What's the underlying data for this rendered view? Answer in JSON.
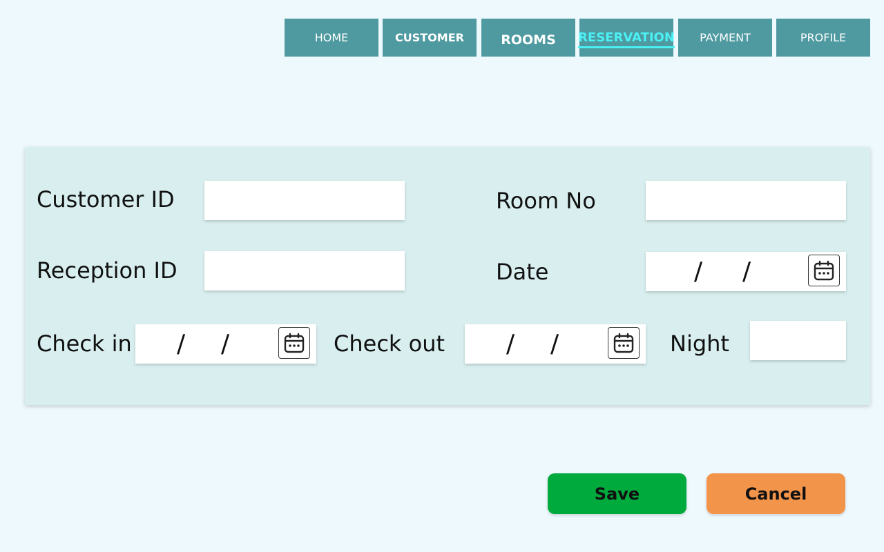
{
  "nav": {
    "tabs": [
      {
        "label": "HOME"
      },
      {
        "label": "CUSTOMER"
      },
      {
        "label": "ROOMS"
      },
      {
        "label": "RESERVATION",
        "active": true
      },
      {
        "label": "PAYMENT"
      },
      {
        "label": "PROFILE"
      }
    ]
  },
  "form": {
    "customer_id_label": "Customer ID",
    "customer_id_value": "",
    "room_no_label": "Room No",
    "room_no_value": "",
    "reception_id_label": "Reception ID",
    "reception_id_value": "",
    "date_label": "Date",
    "check_in_label": "Check in",
    "check_out_label": "Check out",
    "night_label": "Night",
    "night_value": "",
    "date_separator": "/",
    "calendar_icon": "calendar-icon"
  },
  "actions": {
    "save_label": "Save",
    "cancel_label": "Cancel"
  },
  "colors": {
    "background": "#eef9fd",
    "nav_tab": "#4e9aa0",
    "nav_active_text": "#4bf0f4",
    "panel": "#d9efef",
    "save": "#00aa3c",
    "cancel": "#f2944a"
  }
}
